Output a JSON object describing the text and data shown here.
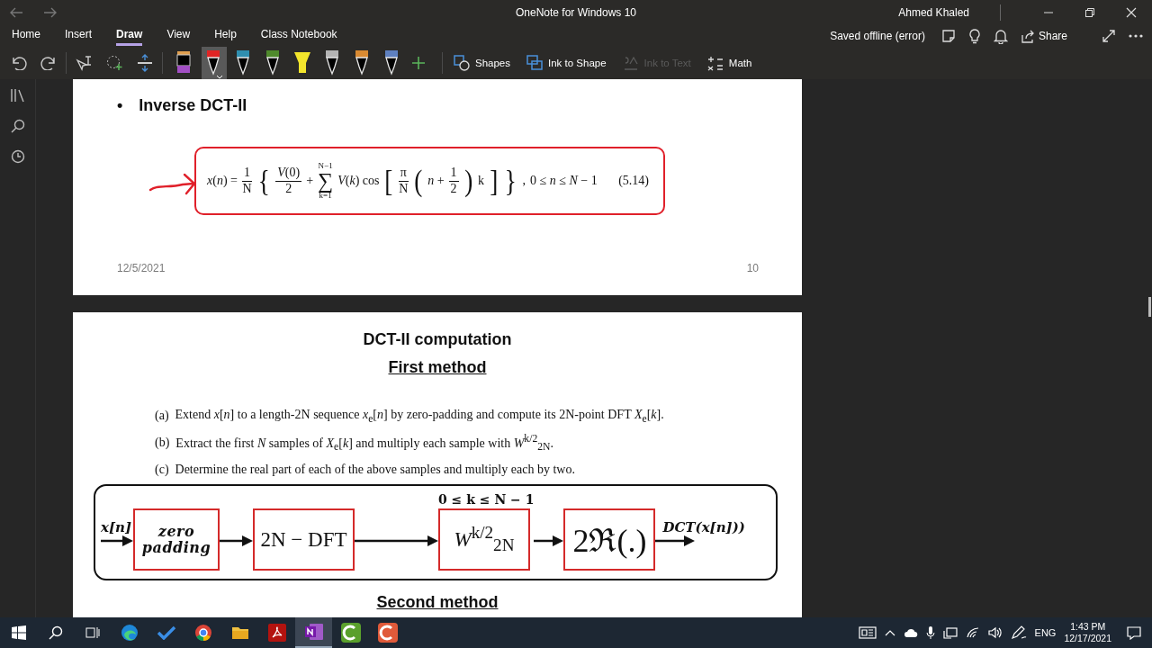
{
  "window": {
    "title": "OneNote for Windows 10",
    "user": "Ahmed Khaled"
  },
  "ribbon_tabs": [
    {
      "label": "Home",
      "selected": false
    },
    {
      "label": "Insert",
      "selected": false
    },
    {
      "label": "Draw",
      "selected": true
    },
    {
      "label": "View",
      "selected": false
    },
    {
      "label": "Help",
      "selected": false
    },
    {
      "label": "Class Notebook",
      "selected": false
    }
  ],
  "status": {
    "sync": "Saved offline (error)",
    "share": "Share"
  },
  "toolbar": {
    "pens": [
      {
        "kind": "marker",
        "color": "#a24fc4",
        "selected": false
      },
      {
        "kind": "pen",
        "color": "#e02424",
        "selected": true
      },
      {
        "kind": "pen",
        "color": "#2f8fb0",
        "selected": false
      },
      {
        "kind": "pen",
        "color": "#4f8a2c",
        "selected": false
      },
      {
        "kind": "highlighter",
        "color": "#f3e52c",
        "selected": false
      },
      {
        "kind": "pen",
        "color": "#b4b4b4",
        "selected": false
      },
      {
        "kind": "pen",
        "color": "#d98a32",
        "selected": false
      },
      {
        "kind": "pen",
        "color": "#5e80c0",
        "selected": false
      }
    ],
    "buttons": [
      {
        "kind": "shapes",
        "label": "Shapes",
        "disabled": false
      },
      {
        "kind": "ink-shape",
        "label": "Ink to Shape",
        "disabled": false
      },
      {
        "kind": "ink-text",
        "label": "Ink to Text",
        "disabled": true
      },
      {
        "kind": "math",
        "label": "Math",
        "disabled": false
      }
    ]
  },
  "slide_1": {
    "bullet": "•",
    "heading": "Inverse DCT-II",
    "formula": [
      {
        "kind": "text",
        "text": "*x*(*n*) ="
      },
      {
        "kind": "frac",
        "num": "1",
        "den": "N"
      },
      {
        "kind": "delim",
        "text": "{"
      },
      {
        "kind": "frac",
        "num": "*V*(0)",
        "den": "2"
      },
      {
        "kind": "text",
        "text": "+"
      },
      {
        "kind": "sum",
        "upper": "N−1",
        "symbol": "∑",
        "lower": "k=1"
      },
      {
        "kind": "text",
        "text": "*V*(*k*) cos"
      },
      {
        "kind": "delim",
        "text": "["
      },
      {
        "kind": "frac",
        "num": "π",
        "den": "N"
      },
      {
        "kind": "delim",
        "text": "("
      },
      {
        "kind": "text",
        "text": "*n* +"
      },
      {
        "kind": "frac",
        "num": "1",
        "den": "2"
      },
      {
        "kind": "delim",
        "text": ")"
      },
      {
        "kind": "text",
        "text": "k"
      },
      {
        "kind": "delim",
        "text": "]"
      },
      {
        "kind": "delim",
        "text": "}"
      },
      {
        "kind": "text",
        "text": ","
      },
      {
        "kind": "text",
        "text": "0 ≤ *n* ≤ *N* − 1"
      },
      {
        "kind": "text",
        "text": "(5.14)"
      }
    ],
    "date": "12/5/2021",
    "page_number": "10"
  },
  "slide_2": {
    "title": "DCT-II computation",
    "subtitle": "First method",
    "steps": [
      {
        "label": "(a)",
        "text": "Extend *x*[*n*] to a length-2N sequence *x*$_{e}$[*n*] by zero-padding and compute its 2N-point DFT *X*$_{e}$[*k*]."
      },
      {
        "label": "(b)",
        "text": "Extract the first *N* samples of *X*$_{e}$[*k*] and multiply each sample with *W*$^{k/2}$$_{2N}$."
      },
      {
        "label": "(c)",
        "text": "Determine the real part of each of the above samples and multiply each by two."
      }
    ],
    "diagram": {
      "input": "x[n]",
      "output": "DCT(x[n]))",
      "blocks": [
        {
          "kind": "word",
          "text": "zero padding"
        },
        {
          "kind": "expr",
          "text": "2N − DFT"
        },
        {
          "kind": "expr",
          "text": "*W*$^{k/2}$$_{2N}$",
          "range": "0 ≤ k ≤ N − 1"
        },
        {
          "kind": "symbol",
          "text": "2ℜ(.)"
        }
      ]
    },
    "next_heading": "Second method"
  },
  "taskbar": {
    "apps": [
      {
        "kind": "start",
        "active": false
      },
      {
        "kind": "search",
        "active": false
      },
      {
        "kind": "task-view",
        "active": false
      },
      {
        "kind": "edge",
        "active": false
      },
      {
        "kind": "todo",
        "active": false
      },
      {
        "kind": "chrome",
        "active": false
      },
      {
        "kind": "explorer",
        "active": false
      },
      {
        "kind": "acrobat",
        "active": false
      },
      {
        "kind": "onenote",
        "active": true
      },
      {
        "kind": "camtasia-green",
        "active": false
      },
      {
        "kind": "camtasia-red",
        "active": false
      }
    ],
    "language": "ENG",
    "time": "1:43 PM",
    "date": "12/17/2021"
  }
}
